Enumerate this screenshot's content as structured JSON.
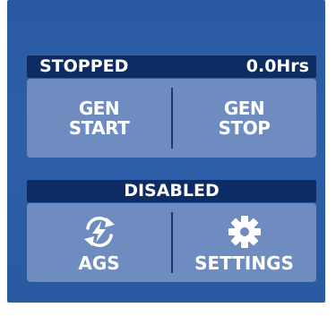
{
  "status": {
    "state": "STOPPED",
    "hours": "0.0Hrs",
    "ags_state": "DISABLED"
  },
  "buttons": {
    "gen_start": [
      "GEN",
      "START"
    ],
    "gen_stop": [
      "GEN",
      "STOP"
    ],
    "ags": "AGS",
    "settings": "SETTINGS"
  },
  "icons": {
    "ags": "ags-cycle-lightning-icon",
    "settings": "gear-icon"
  },
  "colors": {
    "background": "#2b5aa3",
    "status_bar": "#0c2c63",
    "button": "#6e8cc0",
    "text": "#ffffff"
  }
}
